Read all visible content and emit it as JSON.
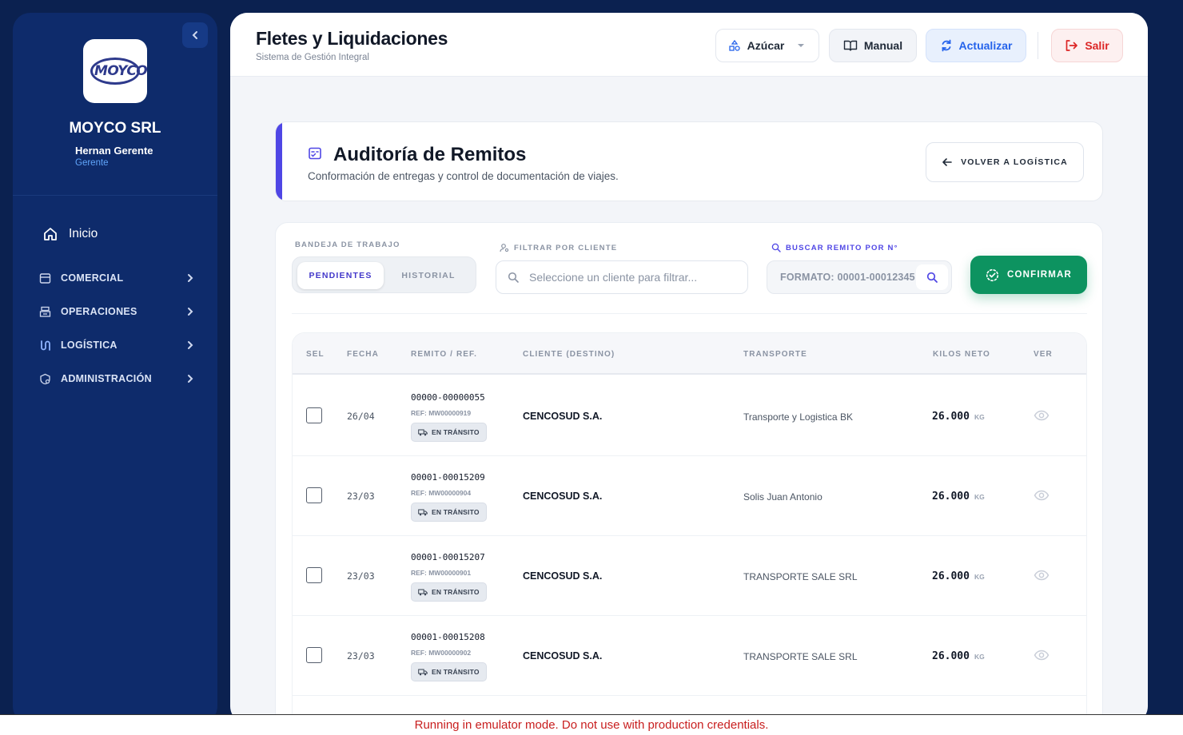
{
  "sidebar": {
    "logo_text": "MOYCO",
    "company": "MOYCO SRL",
    "user_name": "Hernan Gerente",
    "user_role": "Gerente",
    "home_label": "Inicio",
    "items": [
      {
        "label": "COMERCIAL",
        "icon": "store-icon"
      },
      {
        "label": "OPERACIONES",
        "icon": "warehouse-icon"
      },
      {
        "label": "LOGÍSTICA",
        "icon": "route-icon"
      },
      {
        "label": "ADMINISTRACIÓN",
        "icon": "admin-icon"
      }
    ]
  },
  "header": {
    "title": "Fletes y Liquidaciones",
    "subtitle": "Sistema de Gestión Integral",
    "business_select": "Azúcar",
    "manual_label": "Manual",
    "refresh_label": "Actualizar",
    "logout_label": "Salir"
  },
  "page": {
    "title": "Auditoría de Remitos",
    "subtitle": "Conformación de entregas y control de documentación de viajes.",
    "back_label": "VOLVER A LOGÍSTICA"
  },
  "filters": {
    "tray_label": "BANDEJA DE TRABAJO",
    "tab_pending": "PENDIENTES",
    "tab_history": "HISTORIAL",
    "client_label": "FILTRAR POR CLIENTE",
    "client_placeholder": "Seleccione un cliente para filtrar...",
    "remito_label": "BUSCAR REMITO POR N°",
    "remito_placeholder": "FORMATO: 00001-00012345",
    "confirm_label": "CONFIRMAR"
  },
  "table": {
    "columns": [
      "SEL",
      "FECHA",
      "REMITO / REF.",
      "CLIENTE (DESTINO)",
      "TRANSPORTE",
      "KILOS NETO",
      "VER"
    ],
    "status_label": "EN TRÁNSITO",
    "unit": "KG",
    "rows": [
      {
        "fecha": "26/04",
        "remito": "00000-00000055",
        "ref": "REF: MW00000919",
        "cliente": "CENCOSUD S.A.",
        "transporte": "Transporte y Logistica BK",
        "kilos": "26.000"
      },
      {
        "fecha": "23/03",
        "remito": "00001-00015209",
        "ref": "REF: MW00000904",
        "cliente": "CENCOSUD S.A.",
        "transporte": "Solis Juan Antonio",
        "kilos": "26.000"
      },
      {
        "fecha": "23/03",
        "remito": "00001-00015207",
        "ref": "REF: MW00000901",
        "cliente": "CENCOSUD S.A.",
        "transporte": "TRANSPORTE SALE SRL",
        "kilos": "26.000"
      },
      {
        "fecha": "23/03",
        "remito": "00001-00015208",
        "ref": "REF: MW00000902",
        "cliente": "CENCOSUD S.A.",
        "transporte": "TRANSPORTE SALE SRL",
        "kilos": "26.000"
      }
    ]
  },
  "banner": "Running in emulator mode. Do not use with production credentials."
}
